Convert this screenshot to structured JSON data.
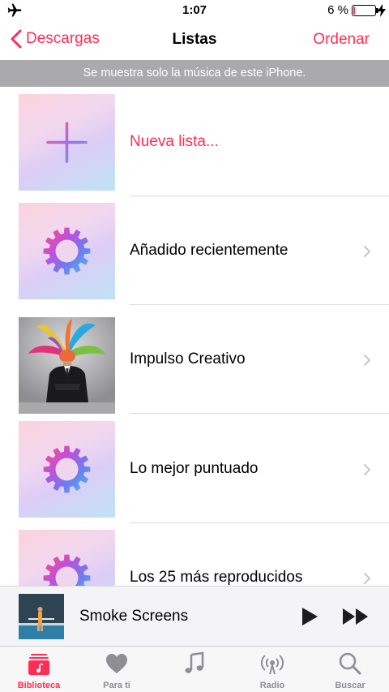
{
  "status_bar": {
    "time": "1:07",
    "battery_percent": "6 %",
    "battery_level": 0.06,
    "icons": [
      "airplane-icon",
      "battery-icon",
      "charging-bolt-icon"
    ]
  },
  "nav": {
    "back_label": "Descargas",
    "title": "Listas",
    "action_label": "Ordenar"
  },
  "banner": {
    "text": "Se muestra solo la música de este iPhone."
  },
  "playlists": [
    {
      "label": "Nueva lista...",
      "icon": "plus-icon"
    },
    {
      "label": "Añadido recientemente",
      "icon": "gear-icon"
    },
    {
      "label": "Impulso Creativo",
      "icon": "album-art"
    },
    {
      "label": "Lo mejor puntuado",
      "icon": "gear-icon"
    },
    {
      "label": "Los 25 más reproducidos",
      "icon": "gear-icon"
    }
  ],
  "now_playing": {
    "song": "Smoke Screens"
  },
  "tabs": [
    {
      "label": "Biblioteca",
      "icon": "library-icon",
      "active": true
    },
    {
      "label": "Para ti",
      "icon": "heart-icon",
      "active": false
    },
    {
      "label": "",
      "icon": "music-note-icon",
      "active": false
    },
    {
      "label": "Radio",
      "icon": "radio-icon",
      "active": false
    },
    {
      "label": "Buscar",
      "icon": "search-icon",
      "active": false
    }
  ],
  "colors": {
    "accent": "#ff2d55",
    "banner_bg": "#aaaaad",
    "tab_inactive": "#8e8e93"
  }
}
